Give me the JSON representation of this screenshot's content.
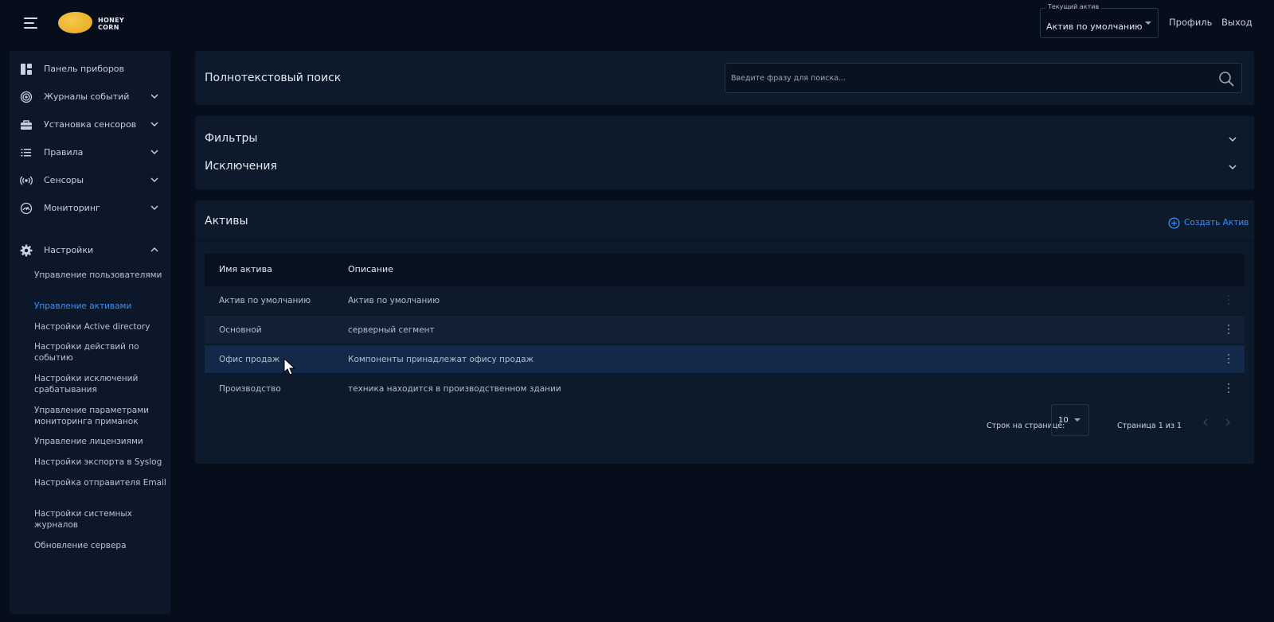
{
  "header": {
    "logo_text_line1": "HONEY",
    "logo_text_line2": "CORN",
    "logo_color": "#f0b830",
    "current_asset_legend": "Текущий актив",
    "current_asset_value": "Актив по умолчанию",
    "profile_link": "Профиль",
    "logout_link": "Выход"
  },
  "sidebar": {
    "items": [
      {
        "label": "Панель приборов",
        "icon": "dashboard-icon",
        "has_chevron": false
      },
      {
        "label": "Журналы событий",
        "icon": "event-log-icon",
        "has_chevron": true
      },
      {
        "label": "Установка сенсоров",
        "icon": "sensor-install-icon",
        "has_chevron": true
      },
      {
        "label": "Правила",
        "icon": "rules-icon",
        "has_chevron": true
      },
      {
        "label": "Сенсоры",
        "icon": "sensors-icon",
        "has_chevron": true
      },
      {
        "label": "Мониторинг",
        "icon": "monitoring-icon",
        "has_chevron": true
      },
      {
        "label": "Настройки",
        "icon": "gear-icon",
        "has_chevron": true,
        "expanded": true
      }
    ],
    "settings_subitems": [
      {
        "label": "Управление пользователями",
        "active": false
      },
      {
        "label": "Управление активами",
        "active": true
      },
      {
        "label": "Настройки Active directory",
        "active": false
      },
      {
        "label": "Настройки действий по событию",
        "active": false
      },
      {
        "label": "Настройки исключений срабатывания",
        "active": false
      },
      {
        "label": "Управление параметрами мониторинга приманок",
        "active": false
      },
      {
        "label": "Управление лицензиями",
        "active": false
      },
      {
        "label": "Настройки экспорта в Syslog",
        "active": false
      },
      {
        "label": "Настройка отправителя Email",
        "active": false
      },
      {
        "label": "Настройки системных журналов",
        "active": false
      },
      {
        "label": "Обновление сервера",
        "active": false
      }
    ]
  },
  "search": {
    "title": "Полнотекстовый поиск",
    "placeholder": "Введите фразу для поиска..."
  },
  "filters": {
    "filters_title": "Фильтры",
    "exclusions_title": "Исключения"
  },
  "assets": {
    "title": "Активы",
    "create_label": "Создать Актив",
    "columns": [
      "Имя актива",
      "Описание"
    ],
    "rows": [
      {
        "name": "Актив по умолчанию",
        "description": "Актив по умолчанию"
      },
      {
        "name": "Основной",
        "description": "серверный сегмент"
      },
      {
        "name": "Офис продаж",
        "description": "Компоненты принадлежат офису продаж"
      },
      {
        "name": "Производство",
        "description": "техника находится в производственном здании"
      }
    ],
    "hovered_row": 2,
    "rows_per_page_label": "Строк на странице:",
    "rows_per_page_value": "10",
    "page_info": "Страница 1 из 1"
  },
  "colors": {
    "background": "#060e1c",
    "panel": "#0d1a2c",
    "accent": "#3a8ef2"
  }
}
